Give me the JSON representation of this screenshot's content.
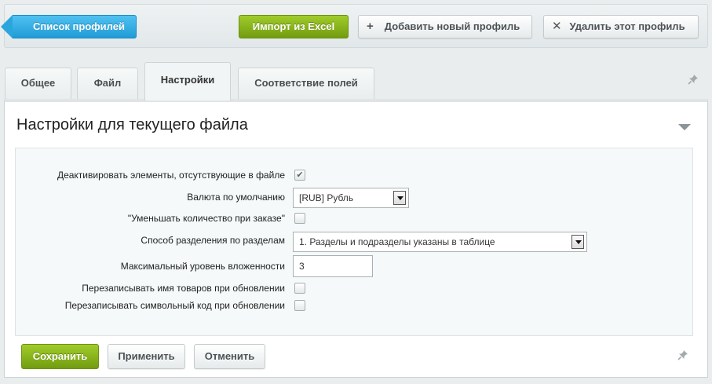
{
  "toolbar": {
    "back_label": "Список профилей",
    "import_label": "Импорт из Excel",
    "add_label": "Добавить новый профиль",
    "delete_label": "Удалить этот профиль"
  },
  "tabs": [
    {
      "label": "Общее",
      "active": false
    },
    {
      "label": "Файл",
      "active": false
    },
    {
      "label": "Настройки",
      "active": true
    },
    {
      "label": "Соответствие полей",
      "active": false
    }
  ],
  "panel": {
    "title": "Настройки для текущего файла"
  },
  "form": {
    "deactivate": {
      "label": "Деактивировать элементы, отсутствующие в файле",
      "checked": true
    },
    "currency": {
      "label": "Валюта по умолчанию",
      "value": "[RUB] Рубль"
    },
    "reduce_qty": {
      "label": "\"Уменьшать количество при заказе\"",
      "checked": false
    },
    "section_mode": {
      "label": "Способ разделения по разделам",
      "value": "1. Разделы и подразделы указаны в таблице"
    },
    "max_depth": {
      "label": "Максимальный уровень вложенности",
      "value": "3"
    },
    "overwrite_name": {
      "label": "Перезаписывать имя товаров при обновлении",
      "checked": false
    },
    "overwrite_code": {
      "label": "Перезаписывать символьный код при обновлении",
      "checked": false
    }
  },
  "actions": {
    "save_label": "Сохранить",
    "apply_label": "Применить",
    "cancel_label": "Отменить"
  },
  "colors": {
    "accent_blue": "#219bd6",
    "accent_green": "#729c10"
  }
}
